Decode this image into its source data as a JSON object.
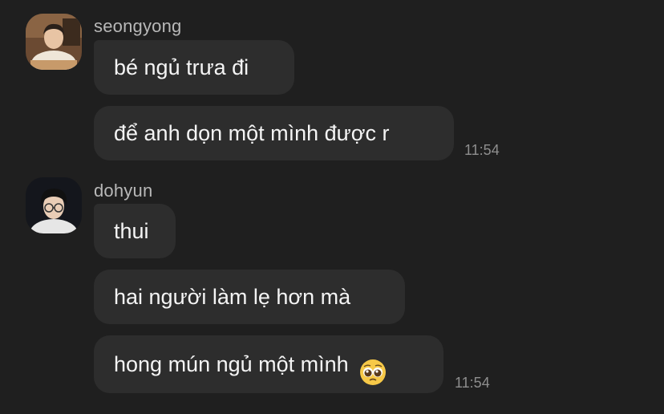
{
  "groups": [
    {
      "sender": "seongyong",
      "avatar_icon": "user-avatar-seongyong",
      "messages": [
        "bé ngủ trưa đi",
        "để anh dọn một mình được r"
      ],
      "time": "11:54"
    },
    {
      "sender": "dohyun",
      "avatar_icon": "user-avatar-dohyun",
      "messages": [
        "thui",
        "hai người làm lẹ hơn mà",
        "hong mún ngủ một mình"
      ],
      "emoji": "pleading-face-emoji",
      "time": "11:54"
    }
  ],
  "colors": {
    "background": "#1f1f1f",
    "bubble": "#2d2d2d",
    "text": "#f4f4f4",
    "meta": "#8e8e8e"
  }
}
